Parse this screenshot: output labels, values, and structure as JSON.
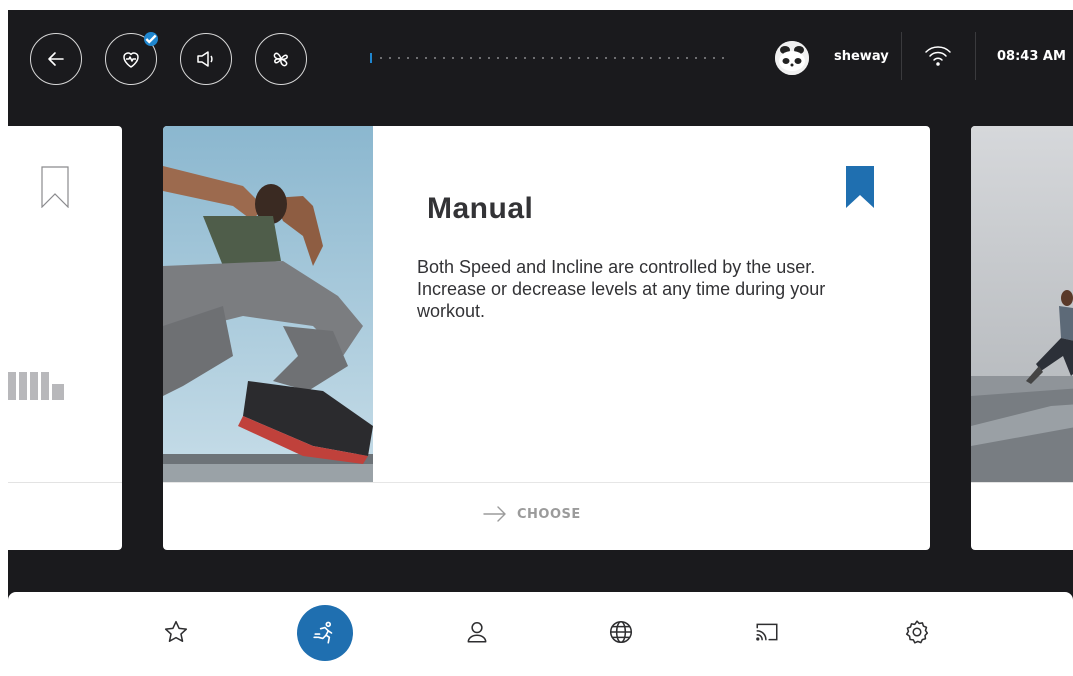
{
  "topbar": {
    "username": "sheway",
    "time": "08:43 AM",
    "buttons": [
      "back-icon",
      "heart-rate-icon",
      "volume-icon",
      "fan-icon"
    ],
    "progress": 0.02
  },
  "main_card": {
    "title": "Manual",
    "description": "Both Speed and Incline are controlled by the user. Increase or decrease levels at any time during your workout.",
    "action_label": "CHOOSE",
    "bookmarked": true
  },
  "bottom_nav": {
    "items": [
      "star-icon",
      "running-icon",
      "user-icon",
      "globe-icon",
      "cast-icon",
      "settings-icon"
    ],
    "active": "running-icon"
  },
  "colors": {
    "accent": "#1f6fb0",
    "badge": "#1f86cf",
    "background": "#1a1a1d"
  }
}
